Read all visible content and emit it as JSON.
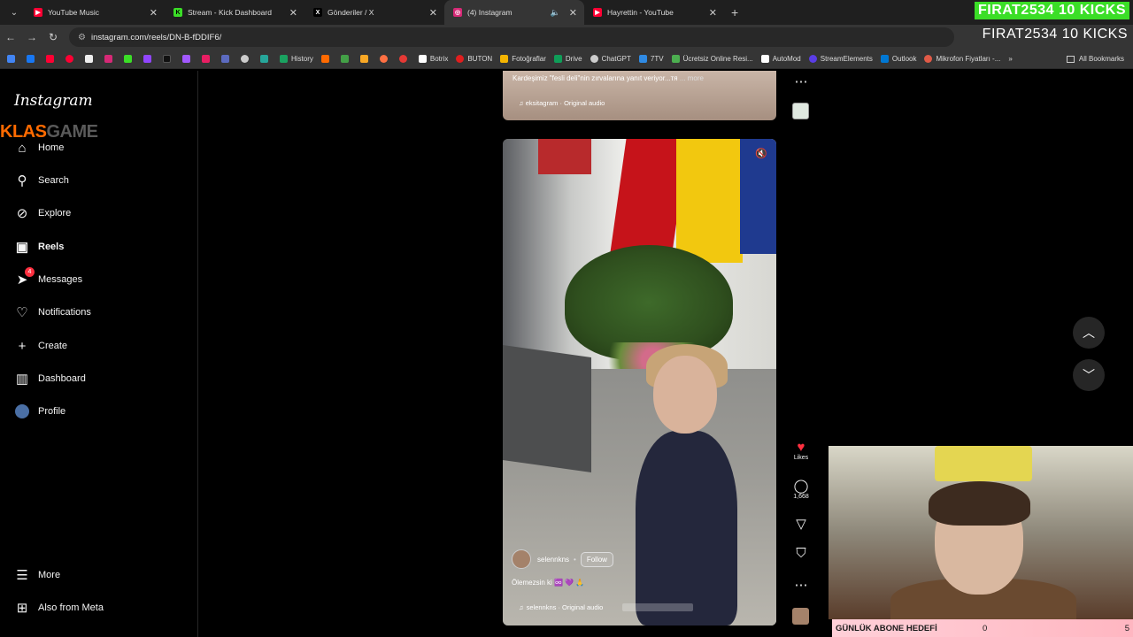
{
  "tabs": [
    {
      "label": "YouTube Music",
      "color": "#ff0033",
      "active": false
    },
    {
      "label": "Stream - Kick Dashboard",
      "color": "#3bde27",
      "active": false
    },
    {
      "label": "Gönderiler / X",
      "color": "#000000",
      "active": false
    },
    {
      "label": "(4) Instagram",
      "color": "#d62976",
      "active": true
    },
    {
      "label": "Hayrettin - YouTube",
      "color": "#ff0033",
      "active": false
    }
  ],
  "kick_banner": "FIRAT2534  10 KICKS",
  "kick_overlay": "FIRAT2534  10 KICKS",
  "address": "instagram.com/reels/DN-B-fDDIF6/",
  "bookmarks": [
    {
      "label": "History",
      "color": "#1aa260"
    },
    {
      "label": "",
      "color": "#ff6a00"
    },
    {
      "label": "Botrix",
      "color": "#ffffff"
    },
    {
      "label": "BUTON",
      "color": "#e01e1e"
    },
    {
      "label": "Fotoğraflar",
      "color": "#f4b400"
    },
    {
      "label": "Drive",
      "color": "#0f9d58"
    },
    {
      "label": "ChatGPT",
      "color": "#cccccc"
    },
    {
      "label": "7TV",
      "color": "#2f8ae3"
    },
    {
      "label": "Ücretsiz Online Resi...",
      "color": "#4caf50"
    },
    {
      "label": "AutoMod",
      "color": "#ffffff"
    },
    {
      "label": "StreamElements",
      "color": "#5a3de6"
    },
    {
      "label": "Outlook",
      "color": "#0078d4"
    },
    {
      "label": "Mikrofon Fiyatları -...",
      "color": "#e05a47"
    }
  ],
  "all_bookmarks": "All Bookmarks",
  "sidebar": {
    "logo": "Instagram",
    "overlay_left": "KLAS",
    "overlay_right": "GAME",
    "items": [
      {
        "label": "Home",
        "icon": "home-icon"
      },
      {
        "label": "Search",
        "icon": "search-icon"
      },
      {
        "label": "Explore",
        "icon": "compass-icon"
      },
      {
        "label": "Reels",
        "icon": "reels-icon"
      },
      {
        "label": "Messages",
        "icon": "messenger-icon",
        "badge": "4"
      },
      {
        "label": "Notifications",
        "icon": "heart-icon"
      },
      {
        "label": "Create",
        "icon": "plus-icon"
      },
      {
        "label": "Dashboard",
        "icon": "chart-icon"
      },
      {
        "label": "Profile",
        "icon": "avatar-icon"
      }
    ],
    "more": "More",
    "also_meta": "Also from Meta"
  },
  "prev_reel": {
    "caption": "Kardeşimiz \"fesli deli\"nin zırvalarına yanıt veriyor...тя",
    "more": "... more",
    "audio": "eksitagram · Original audio"
  },
  "reel": {
    "username": "selennkns",
    "follow": "Follow",
    "caption": "Ölemezsin ki ♾️ 💜 🙏",
    "audio": "selennkns · Original audio"
  },
  "actions": {
    "likes": "Likes",
    "comments": "1,668"
  },
  "goal": {
    "label": "GÜNLÜK ABONE HEDEFİ",
    "current": "0",
    "target": "5"
  }
}
